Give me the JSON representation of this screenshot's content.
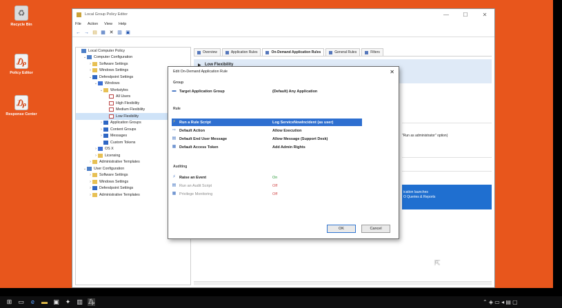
{
  "desktop": {
    "icons": [
      {
        "label": "Recycle Bin",
        "icon": "recycle-bin-icon"
      },
      {
        "label": "Policy Editor",
        "icon": "policy-editor-icon"
      },
      {
        "label": "Response Center",
        "icon": "response-center-icon"
      }
    ]
  },
  "window": {
    "title": "Local Group Policy Editor",
    "controls": [
      "—",
      "☐",
      "✕"
    ],
    "menu": [
      "File",
      "Action",
      "View",
      "Help"
    ]
  },
  "tree": [
    {
      "label": "Local Computer Policy",
      "depth": 0,
      "icon": "pc"
    },
    {
      "label": "Computer Configuration",
      "depth": 1,
      "icon": "pc",
      "exp": "v"
    },
    {
      "label": "Software Settings",
      "depth": 2,
      "icon": "folder",
      "exp": ">"
    },
    {
      "label": "Windows Settings",
      "depth": 2,
      "icon": "folder",
      "exp": ">"
    },
    {
      "label": "Defendpoint Settings",
      "depth": 2,
      "icon": "blue",
      "exp": "v"
    },
    {
      "label": "Windows",
      "depth": 3,
      "icon": "grid",
      "exp": "v"
    },
    {
      "label": "Workstyles",
      "depth": 4,
      "icon": "folder",
      "exp": "v"
    },
    {
      "label": "All Users",
      "depth": 5,
      "icon": "doc"
    },
    {
      "label": "High Flexibility",
      "depth": 5,
      "icon": "doc"
    },
    {
      "label": "Medium Flexibility",
      "depth": 5,
      "icon": "doc"
    },
    {
      "label": "Low Flexibility",
      "depth": 5,
      "icon": "doc",
      "sel": true
    },
    {
      "label": "Application Groups",
      "depth": 4,
      "icon": "blue",
      "exp": ">"
    },
    {
      "label": "Content Groups",
      "depth": 4,
      "icon": "blue",
      "exp": ">"
    },
    {
      "label": "Messages",
      "depth": 4,
      "icon": "blue",
      "exp": ">"
    },
    {
      "label": "Custom Tokens",
      "depth": 4,
      "icon": "blue",
      "exp": ""
    },
    {
      "label": "OS X",
      "depth": 3,
      "icon": "grid",
      "exp": ">"
    },
    {
      "label": "Licensing",
      "depth": 3,
      "icon": "folder",
      "exp": ">"
    },
    {
      "label": "Administrative Templates",
      "depth": 2,
      "icon": "folder",
      "exp": ">"
    },
    {
      "label": "User Configuration",
      "depth": 1,
      "icon": "pc",
      "exp": "v"
    },
    {
      "label": "Software Settings",
      "depth": 2,
      "icon": "folder",
      "exp": ">"
    },
    {
      "label": "Windows Settings",
      "depth": 2,
      "icon": "folder",
      "exp": ">"
    },
    {
      "label": "Defendpoint Settings",
      "depth": 2,
      "icon": "blue",
      "exp": ">"
    },
    {
      "label": "Administrative Templates",
      "depth": 2,
      "icon": "folder",
      "exp": ">"
    }
  ],
  "tabs": [
    "Overview",
    "Application Rules",
    "On-Demand Application Rules",
    "General Rules",
    "Filters"
  ],
  "panel": {
    "title": "Low Flexibility",
    "note": "\"Run as administrator\" option)",
    "blue_lines": [
      "ication launches",
      "O Queries & Reports"
    ]
  },
  "dialog": {
    "title": "Edit On-Demand Application Rule",
    "close": "✕",
    "sections": {
      "group": "Group",
      "rule": "Rule",
      "auditing": "Auditing"
    },
    "rows": [
      {
        "label": "Target Application Group",
        "value": "(Default) Any Application",
        "kind": "normal",
        "icon": "folder-icon"
      },
      {
        "label": "Run a Rule Script",
        "value": "Log ServiceNowIncident (as user)",
        "kind": "sel",
        "icon": "script-icon"
      },
      {
        "label": "Default Action",
        "value": "Allow Execution",
        "kind": "normal",
        "icon": "action-icon"
      },
      {
        "label": "Default End User Message",
        "value": "Allow Message (Support Desk)",
        "kind": "normal",
        "icon": "message-icon"
      },
      {
        "label": "Default Access Token",
        "value": "Add Admin Rights",
        "kind": "normal",
        "icon": "token-icon"
      },
      {
        "label": "Raise an Event",
        "value": "On",
        "kind": "on",
        "icon": "event-icon"
      },
      {
        "label": "Run an Audit Script",
        "value": "Off",
        "kind": "off",
        "icon": "audit-script-icon"
      },
      {
        "label": "Privilege Monitoring",
        "value": "Off",
        "kind": "off",
        "icon": "monitoring-icon"
      }
    ],
    "ok": "OK",
    "cancel": "Cancel"
  }
}
